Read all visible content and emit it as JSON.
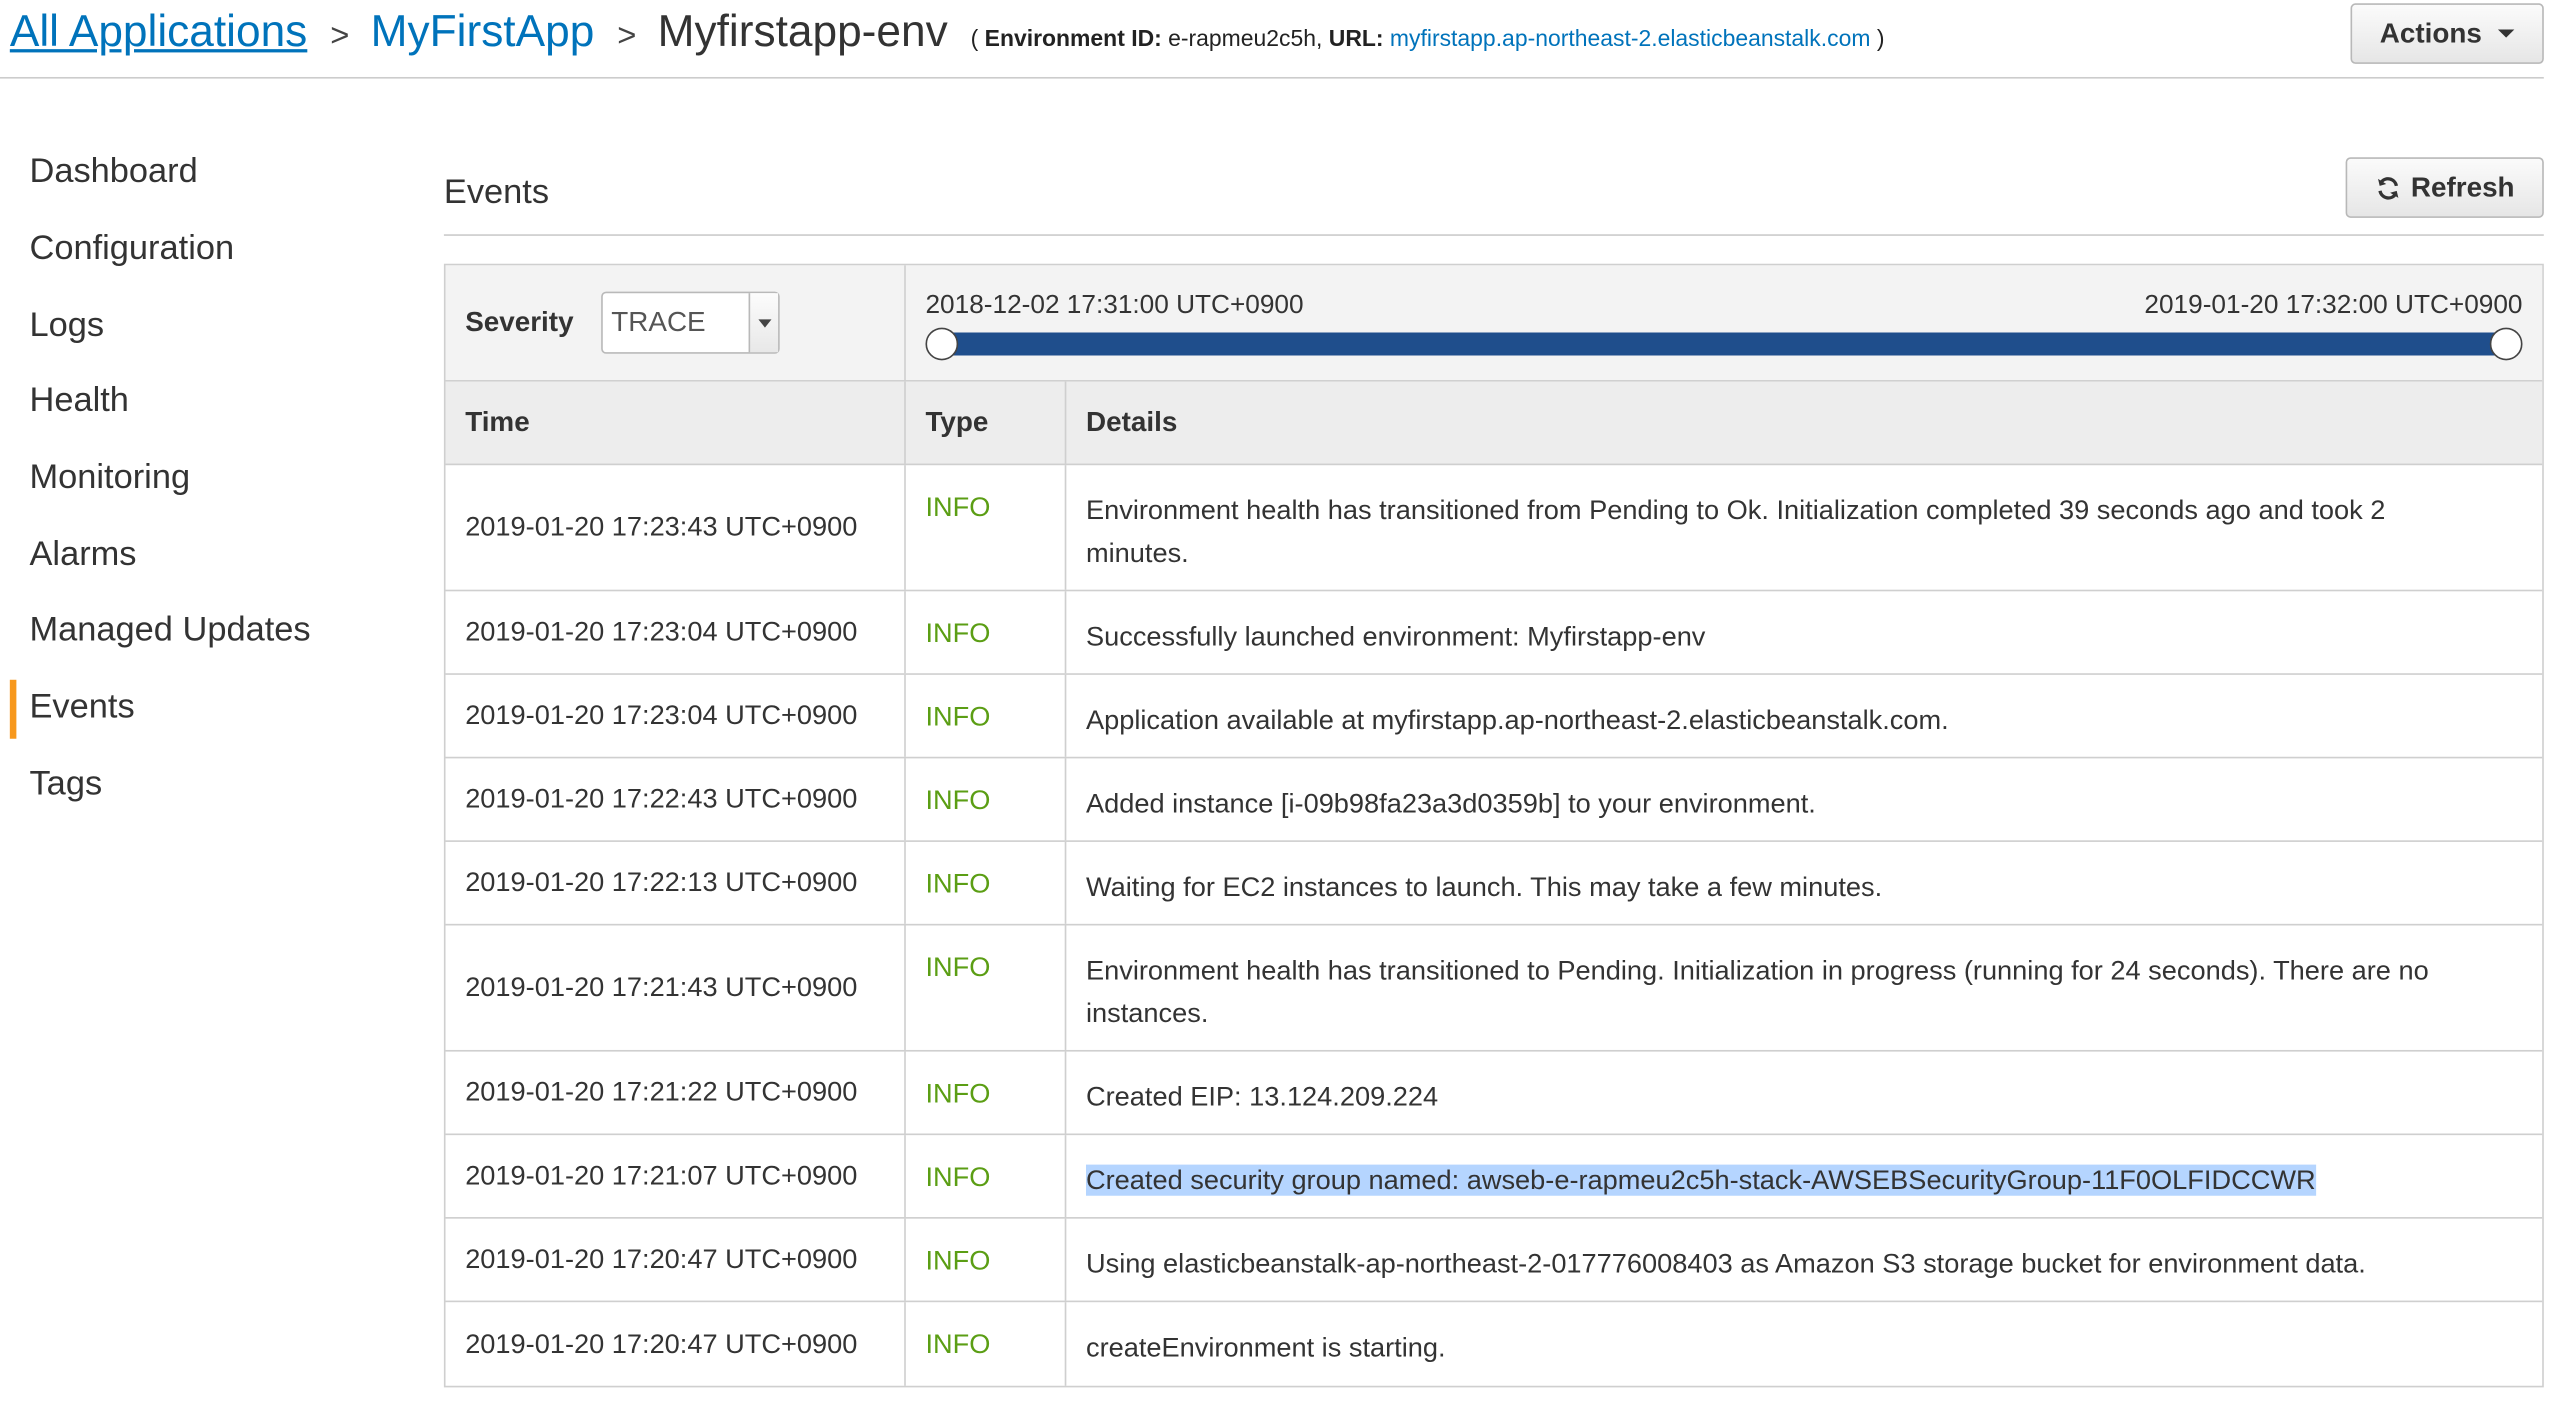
{
  "breadcrumb": {
    "items": [
      "All Applications",
      "MyFirstApp"
    ],
    "current": "Myfirstapp-env",
    "separator": ">",
    "env_open": "(",
    "env_id_label": "Environment ID:",
    "env_id_value": "e-rapmeu2c5h,",
    "url_label": "URL:",
    "url_value": "myfirstapp.ap-northeast-2.elasticbeanstalk.com",
    "env_close": ")"
  },
  "actions_label": "Actions",
  "sidebar": {
    "items": [
      "Dashboard",
      "Configuration",
      "Logs",
      "Health",
      "Monitoring",
      "Alarms",
      "Managed Updates",
      "Events",
      "Tags"
    ],
    "active": "Events"
  },
  "main": {
    "title": "Events",
    "refresh_label": "Refresh"
  },
  "filter": {
    "severity_label": "Severity",
    "severity_value": "TRACE",
    "range_start": "2018-12-02 17:31:00 UTC+0900",
    "range_end": "2019-01-20 17:32:00 UTC+0900"
  },
  "table": {
    "columns": [
      "Time",
      "Type",
      "Details"
    ],
    "rows": [
      {
        "time": "2019-01-20 17:23:43 UTC+0900",
        "type": "INFO",
        "details": "Environment health has transitioned from Pending to Ok. Initialization completed 39 seconds ago and took 2 minutes."
      },
      {
        "time": "2019-01-20 17:23:04 UTC+0900",
        "type": "INFO",
        "details": "Successfully launched environment: Myfirstapp-env"
      },
      {
        "time": "2019-01-20 17:23:04 UTC+0900",
        "type": "INFO",
        "details": "Application available at myfirstapp.ap-northeast-2.elasticbeanstalk.com."
      },
      {
        "time": "2019-01-20 17:22:43 UTC+0900",
        "type": "INFO",
        "details": "Added instance [i-09b98fa23a3d0359b] to your environment."
      },
      {
        "time": "2019-01-20 17:22:13 UTC+0900",
        "type": "INFO",
        "details": "Waiting for EC2 instances to launch. This may take a few minutes."
      },
      {
        "time": "2019-01-20 17:21:43 UTC+0900",
        "type": "INFO",
        "details": "Environment health has transitioned to Pending. Initialization in progress (running for 24 seconds). There are no instances."
      },
      {
        "time": "2019-01-20 17:21:22 UTC+0900",
        "type": "INFO",
        "details": "Created EIP: 13.124.209.224"
      },
      {
        "time": "2019-01-20 17:21:07 UTC+0900",
        "type": "INFO",
        "details": "Created security group named: awseb-e-rapmeu2c5h-stack-AWSEBSecurityGroup-11F0OLFIDCCWR",
        "selected": true
      },
      {
        "time": "2019-01-20 17:20:47 UTC+0900",
        "type": "INFO",
        "details": "Using elasticbeanstalk-ap-northeast-2-017776008403 as Amazon S3 storage bucket for environment data."
      },
      {
        "time": "2019-01-20 17:20:47 UTC+0900",
        "type": "INFO",
        "details": "createEnvironment is starting."
      }
    ]
  },
  "colors": {
    "link": "#0073bb",
    "info": "#5b9e14",
    "active_marker": "#f7981c",
    "range_bar": "#1f4e8c",
    "selection": "#b5d5ff"
  }
}
